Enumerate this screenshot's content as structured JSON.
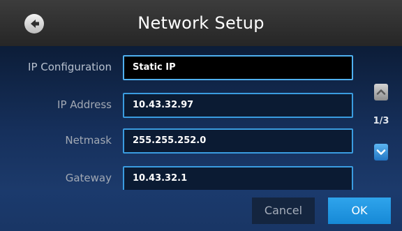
{
  "header": {
    "title": "Network Setup",
    "back_icon": "back-arrow-icon"
  },
  "form": {
    "fields": [
      {
        "label": "IP Configuration",
        "value": "Static IP",
        "selected": true
      },
      {
        "label": "IP Address",
        "value": "10.43.32.97",
        "selected": false
      },
      {
        "label": "Netmask",
        "value": "255.255.252.0",
        "selected": false
      },
      {
        "label": "Gateway",
        "value": "10.43.32.1",
        "selected": false
      }
    ]
  },
  "pagination": {
    "indicator": "1/3",
    "up_icon": "chevron-up-icon",
    "down_icon": "chevron-down-icon"
  },
  "footer": {
    "cancel_label": "Cancel",
    "ok_label": "OK"
  },
  "colors": {
    "accent": "#1e96e2",
    "field_border": "#3a9ce0",
    "panel_bg": "#16305c",
    "header_bg": "#303030"
  }
}
